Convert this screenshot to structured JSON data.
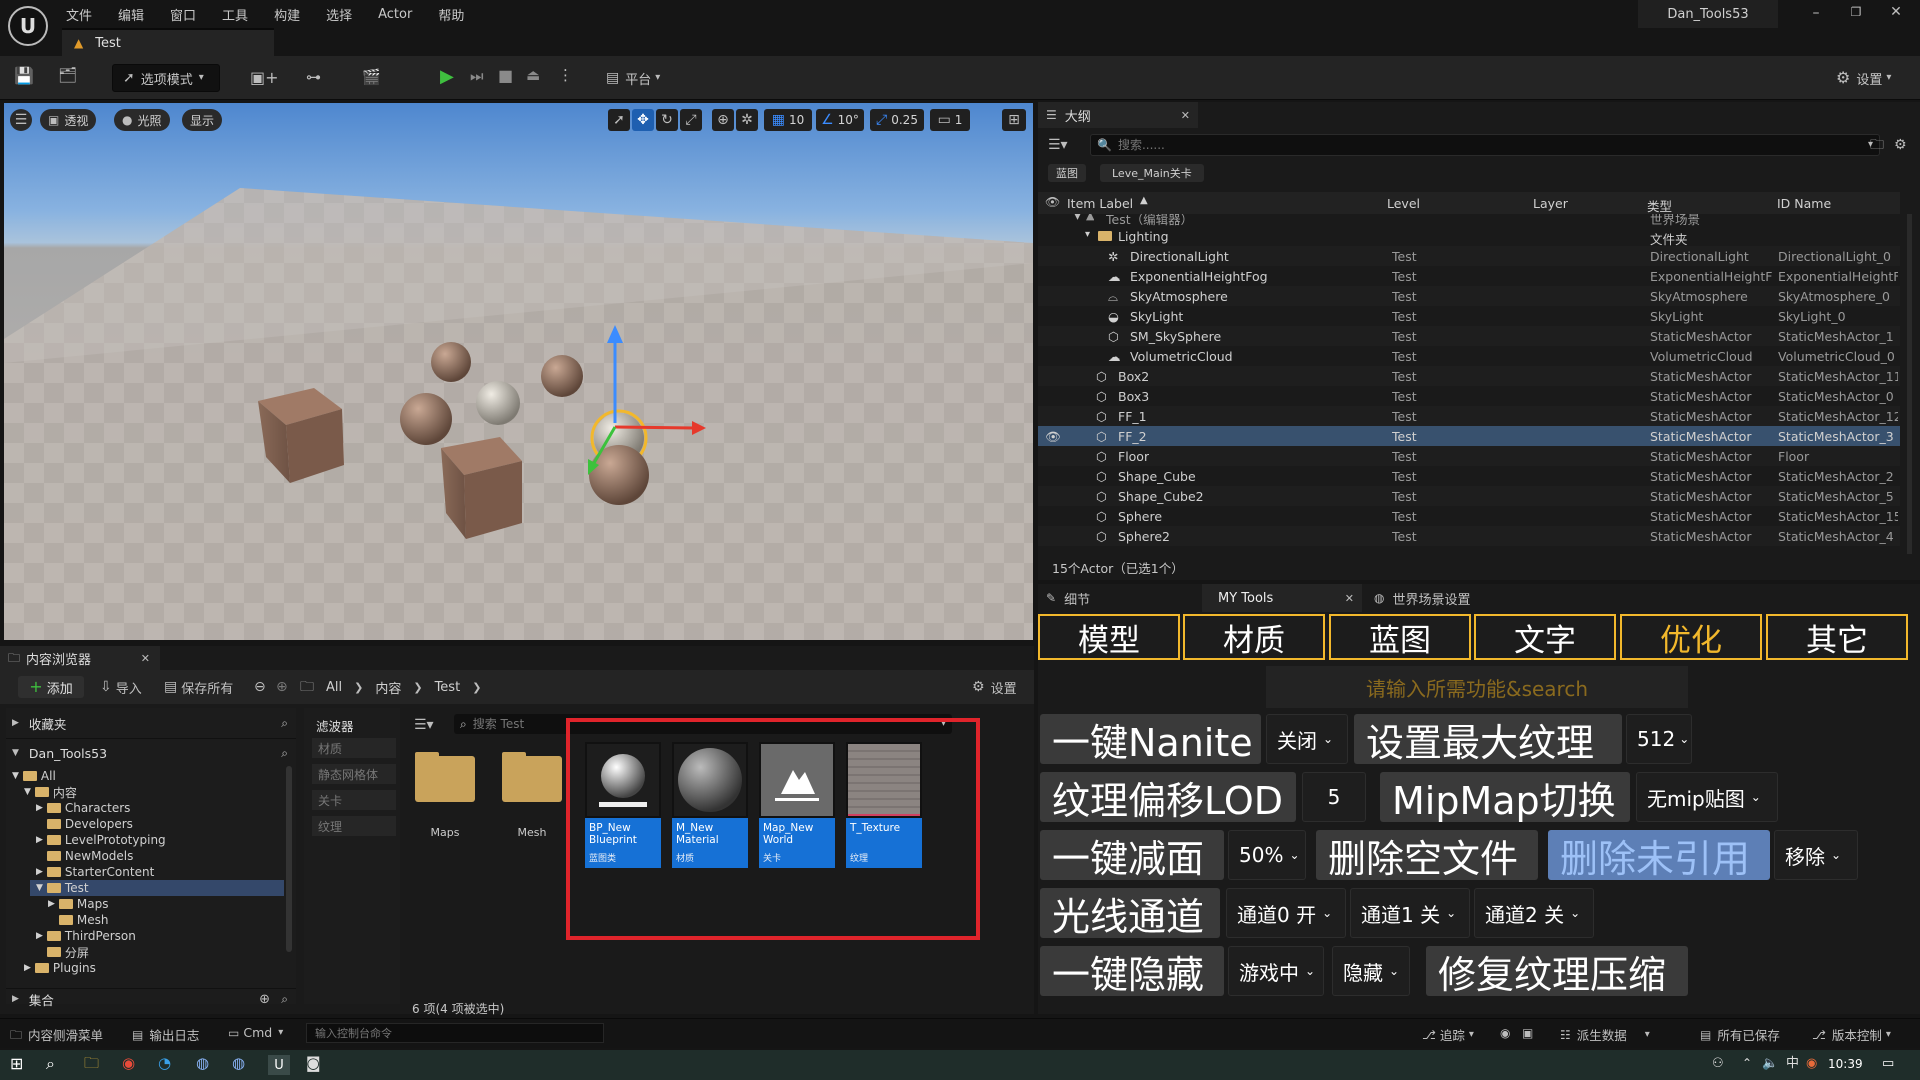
{
  "menu": [
    "文件",
    "编辑",
    "窗口",
    "工具",
    "构建",
    "选择",
    "Actor",
    "帮助"
  ],
  "window_title": "Dan_Tools53",
  "level_tab": "Test",
  "toolbar": {
    "select_mode": "选项模式",
    "platform": "平台",
    "settings": "设置"
  },
  "viewport": {
    "perspective": "透视",
    "lighting": "光照",
    "show": "显示",
    "grid_snap": "10",
    "angle_snap": "10°",
    "scale_snap": "0.25",
    "camera_speed": "1"
  },
  "outliner": {
    "tab": "大纲",
    "search_placeholder": "搜索......",
    "filter_chips": [
      "蓝图",
      "Leve_Main关卡"
    ],
    "columns": [
      "Item Label",
      "Level",
      "Layer",
      "类型",
      "ID Name"
    ],
    "rows": [
      {
        "label": "Test（编辑器）",
        "level": "",
        "type": "世界场景",
        "id": ""
      },
      {
        "label": "Lighting",
        "level": "",
        "type": "文件夹",
        "id": ""
      },
      {
        "label": "DirectionalLight",
        "level": "Test",
        "type": "DirectionalLight",
        "id": "DirectionalLight_0"
      },
      {
        "label": "ExponentialHeightFog",
        "level": "Test",
        "type": "ExponentialHeightFog",
        "id": "ExponentialHeightFog"
      },
      {
        "label": "SkyAtmosphere",
        "level": "Test",
        "type": "SkyAtmosphere",
        "id": "SkyAtmosphere_0"
      },
      {
        "label": "SkyLight",
        "level": "Test",
        "type": "SkyLight",
        "id": "SkyLight_0"
      },
      {
        "label": "SM_SkySphere",
        "level": "Test",
        "type": "StaticMeshActor",
        "id": "StaticMeshActor_1"
      },
      {
        "label": "VolumetricCloud",
        "level": "Test",
        "type": "VolumetricCloud",
        "id": "VolumetricCloud_0"
      },
      {
        "label": "Box2",
        "level": "Test",
        "type": "StaticMeshActor",
        "id": "StaticMeshActor_11"
      },
      {
        "label": "Box3",
        "level": "Test",
        "type": "StaticMeshActor",
        "id": "StaticMeshActor_0"
      },
      {
        "label": "FF_1",
        "level": "Test",
        "type": "StaticMeshActor",
        "id": "StaticMeshActor_12"
      },
      {
        "label": "FF_2",
        "level": "Test",
        "type": "StaticMeshActor",
        "id": "StaticMeshActor_3"
      },
      {
        "label": "Floor",
        "level": "Test",
        "type": "StaticMeshActor",
        "id": "Floor"
      },
      {
        "label": "Shape_Cube",
        "level": "Test",
        "type": "StaticMeshActor",
        "id": "StaticMeshActor_2"
      },
      {
        "label": "Shape_Cube2",
        "level": "Test",
        "type": "StaticMeshActor",
        "id": "StaticMeshActor_5"
      },
      {
        "label": "Sphere",
        "level": "Test",
        "type": "StaticMeshActor",
        "id": "StaticMeshActor_15"
      },
      {
        "label": "Sphere2",
        "level": "Test",
        "type": "StaticMeshActor",
        "id": "StaticMeshActor_4"
      }
    ],
    "footer": "15个Actor（已选1个）"
  },
  "details": {
    "tabs": [
      "细节",
      "MY Tools",
      "世界场景设置"
    ],
    "categories": [
      "模型",
      "材质",
      "蓝图",
      "文字",
      "优化",
      "其它"
    ],
    "search_placeholder": "请输入所需功能&search",
    "buttons": {
      "nanite": "一键Nanite",
      "nanite_dd": "关闭",
      "max_texture": "设置最大纹理",
      "max_texture_dd": "512",
      "lod_offset": "纹理偏移LOD",
      "lod_value": "5",
      "mipmap": "MipMap切换",
      "mipmap_dd": "无mip贴图",
      "reduce": "一键减面",
      "reduce_dd": "50%",
      "delete_empty": "删除空文件",
      "delete_unref": "删除未引用",
      "delete_unref_dd": "移除",
      "light_channel": "光线通道",
      "ch0": "通道0 开",
      "ch1": "通道1 关",
      "ch2": "通道2 关",
      "hide": "一键隐藏",
      "hide_dd1": "游戏中",
      "hide_dd2": "隐藏",
      "fix_compress": "修复纹理压缩"
    }
  },
  "content_browser": {
    "tab": "内容浏览器",
    "add": "添加",
    "import": "导入",
    "save_all": "保存所有",
    "settings": "设置",
    "breadcrumb": [
      "All",
      "内容",
      "Test"
    ],
    "favorites": "收藏夹",
    "project": "Dan_Tools53",
    "collections": "集合",
    "filters_title": "滤波器",
    "filters": [
      "材质",
      "静态网格体",
      "关卡",
      "纹理"
    ],
    "search_placeholder": "搜索 Test",
    "tree": [
      {
        "label": "All",
        "depth": 0
      },
      {
        "label": "内容",
        "depth": 1
      },
      {
        "label": "Characters",
        "depth": 2
      },
      {
        "label": "Developers",
        "depth": 2
      },
      {
        "label": "LevelPrototyping",
        "depth": 2
      },
      {
        "label": "NewModels",
        "depth": 2
      },
      {
        "label": "StarterContent",
        "depth": 2
      },
      {
        "label": "Test",
        "depth": 2
      },
      {
        "label": "Maps",
        "depth": 3
      },
      {
        "label": "Mesh",
        "depth": 3
      },
      {
        "label": "ThirdPerson",
        "depth": 2
      },
      {
        "label": "分屏",
        "depth": 2
      },
      {
        "label": "Plugins",
        "depth": 1
      }
    ],
    "folders": [
      "Maps",
      "Mesh"
    ],
    "assets": [
      {
        "name": "BP_New Blueprint",
        "kind": "蓝图类"
      },
      {
        "name": "M_New Material",
        "kind": "材质"
      },
      {
        "name": "Map_New World",
        "kind": "关卡"
      },
      {
        "name": "T_Texture",
        "kind": "纹理"
      }
    ],
    "count": "6 项(4 项被选中)"
  },
  "statusbar": {
    "drawer": "内容侧滑菜单",
    "output_log": "输出日志",
    "cmd": "Cmd",
    "console_placeholder": "输入控制台命令",
    "trace": "追踪",
    "derived_data": "派生数据",
    "all_saved": "所有已保存",
    "source_control": "版本控制"
  },
  "taskbar": {
    "time": "10:39"
  },
  "colors": {
    "accent_yellow": "#f2b82c",
    "selection_blue": "#1671d6",
    "highlight_red": "#e0242b"
  }
}
